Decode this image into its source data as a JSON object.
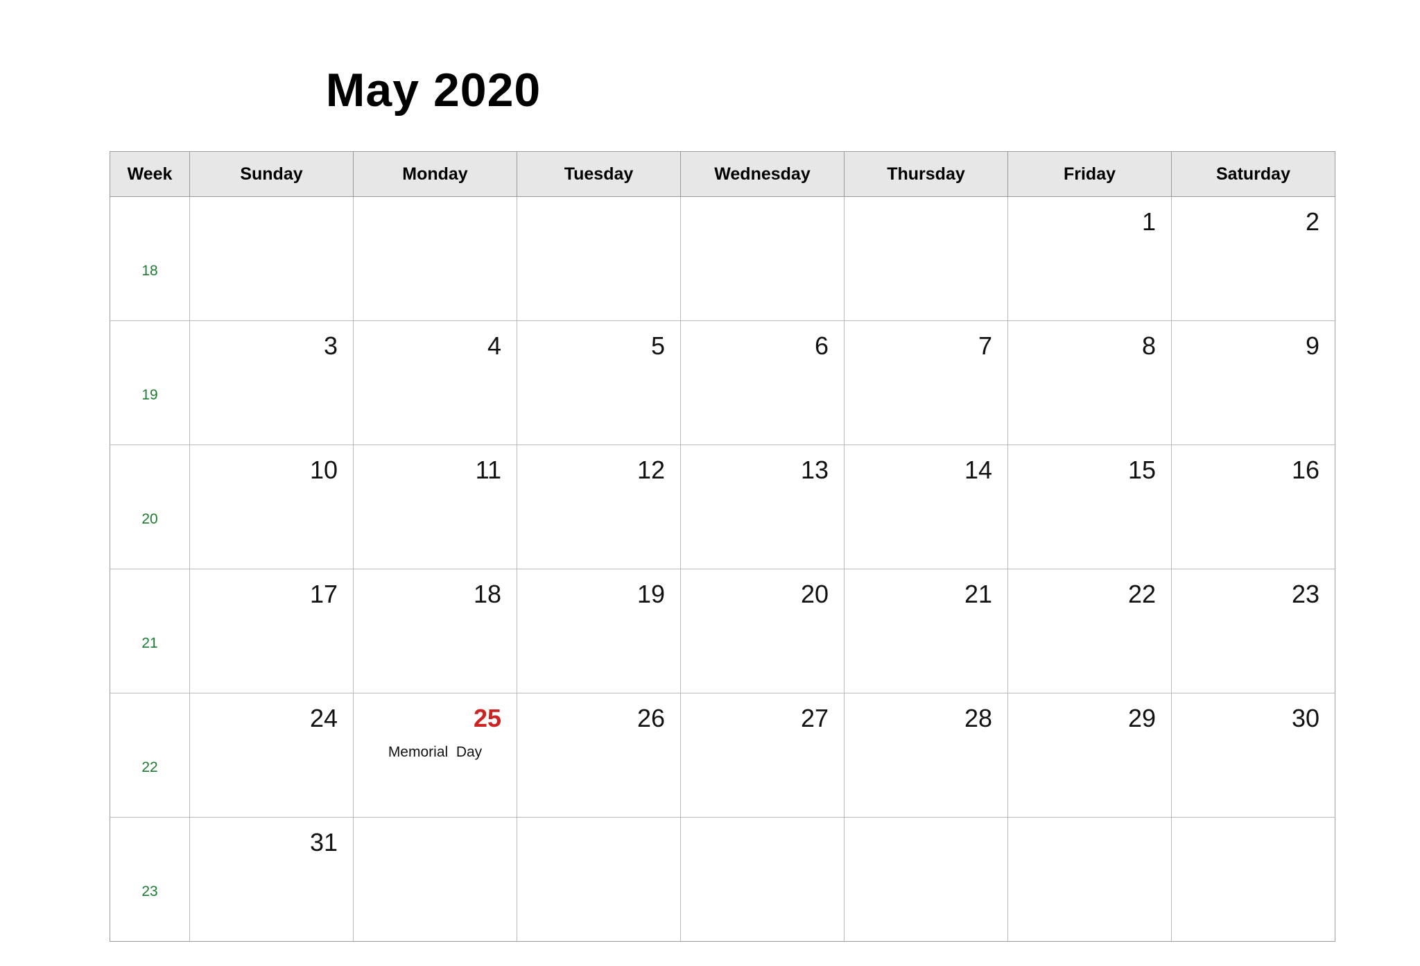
{
  "title": "May 2020",
  "header": {
    "week_label": "Week",
    "days": [
      "Sunday",
      "Monday",
      "Tuesday",
      "Wednesday",
      "Thursday",
      "Friday",
      "Saturday"
    ]
  },
  "colors": {
    "week_number": "#1c7a31",
    "holiday": "#cc2222",
    "header_background": "#e7e7e7",
    "grid_line": "#b9b9b9",
    "outer_border": "#9a9a9a",
    "text": "#111111"
  },
  "weeks": [
    {
      "week": "18",
      "days": [
        {
          "num": "",
          "event": ""
        },
        {
          "num": "",
          "event": ""
        },
        {
          "num": "",
          "event": ""
        },
        {
          "num": "",
          "event": ""
        },
        {
          "num": "",
          "event": ""
        },
        {
          "num": "1",
          "event": ""
        },
        {
          "num": "2",
          "event": ""
        }
      ]
    },
    {
      "week": "19",
      "days": [
        {
          "num": "3",
          "event": ""
        },
        {
          "num": "4",
          "event": ""
        },
        {
          "num": "5",
          "event": ""
        },
        {
          "num": "6",
          "event": ""
        },
        {
          "num": "7",
          "event": ""
        },
        {
          "num": "8",
          "event": ""
        },
        {
          "num": "9",
          "event": ""
        }
      ]
    },
    {
      "week": "20",
      "days": [
        {
          "num": "10",
          "event": ""
        },
        {
          "num": "11",
          "event": ""
        },
        {
          "num": "12",
          "event": ""
        },
        {
          "num": "13",
          "event": ""
        },
        {
          "num": "14",
          "event": ""
        },
        {
          "num": "15",
          "event": ""
        },
        {
          "num": "16",
          "event": ""
        }
      ]
    },
    {
      "week": "21",
      "days": [
        {
          "num": "17",
          "event": ""
        },
        {
          "num": "18",
          "event": ""
        },
        {
          "num": "19",
          "event": ""
        },
        {
          "num": "20",
          "event": ""
        },
        {
          "num": "21",
          "event": ""
        },
        {
          "num": "22",
          "event": ""
        },
        {
          "num": "23",
          "event": ""
        }
      ]
    },
    {
      "week": "22",
      "days": [
        {
          "num": "24",
          "event": ""
        },
        {
          "num": "25",
          "event": "Memorial  Day",
          "holiday": true
        },
        {
          "num": "26",
          "event": ""
        },
        {
          "num": "27",
          "event": ""
        },
        {
          "num": "28",
          "event": ""
        },
        {
          "num": "29",
          "event": ""
        },
        {
          "num": "30",
          "event": ""
        }
      ]
    },
    {
      "week": "23",
      "days": [
        {
          "num": "31",
          "event": ""
        },
        {
          "num": "",
          "event": ""
        },
        {
          "num": "",
          "event": ""
        },
        {
          "num": "",
          "event": ""
        },
        {
          "num": "",
          "event": ""
        },
        {
          "num": "",
          "event": ""
        },
        {
          "num": "",
          "event": ""
        }
      ]
    }
  ]
}
